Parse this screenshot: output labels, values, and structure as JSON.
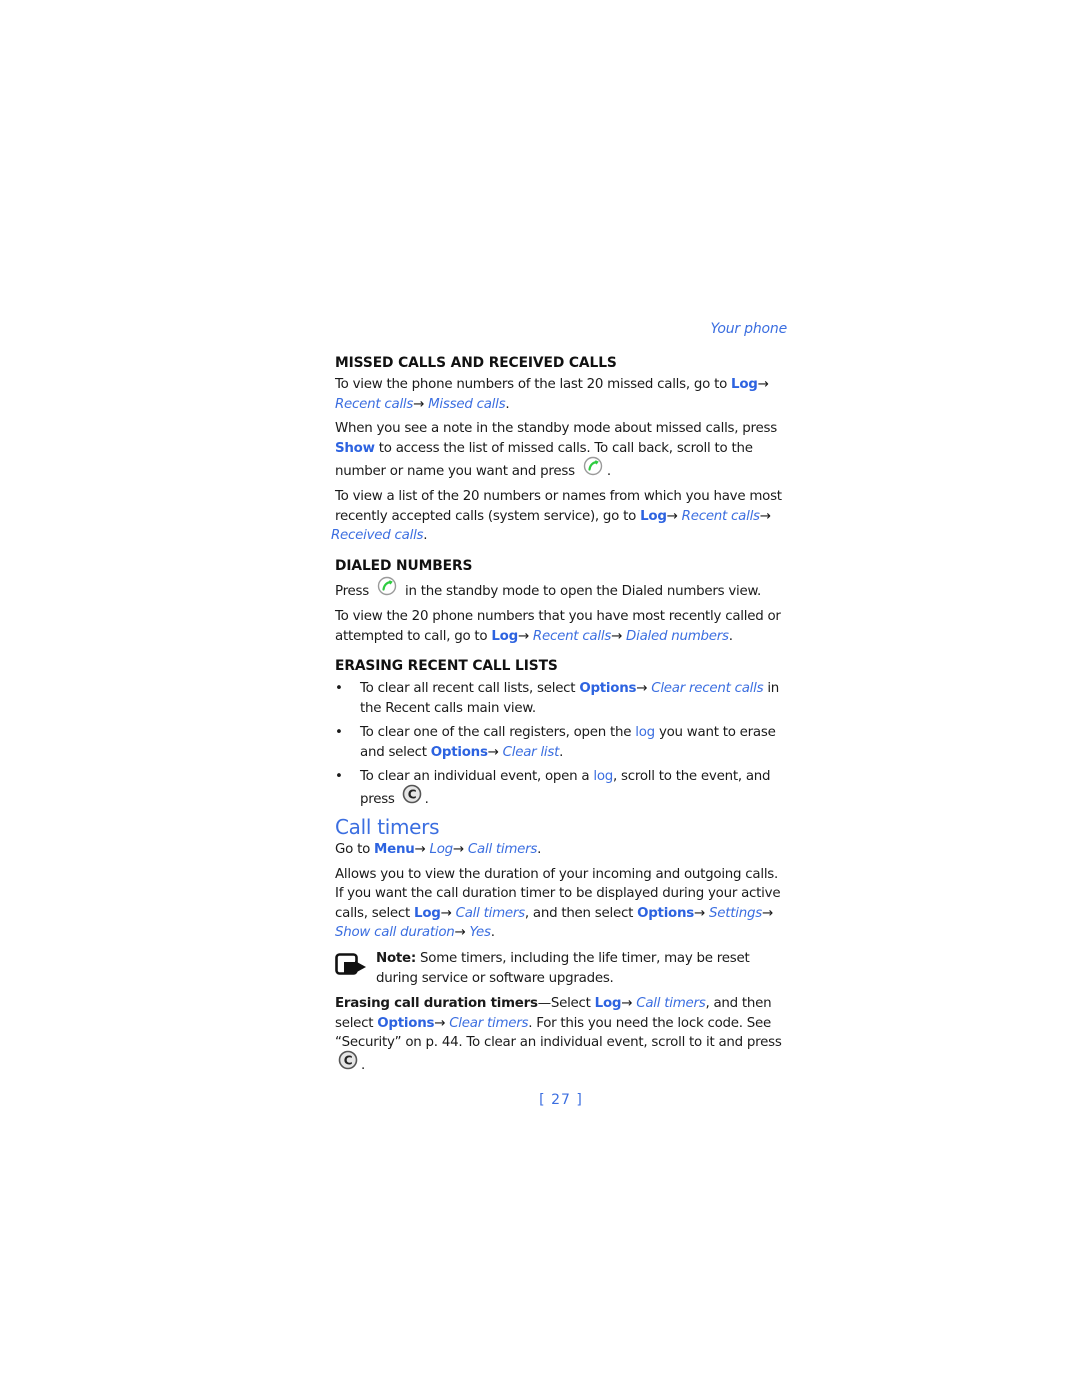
{
  "running_head": "Your phone",
  "missed_received": {
    "heading": "MISSED CALLS AND RECEIVED CALLS",
    "p1": {
      "t1": "To view the phone numbers of the last 20 missed calls, go to ",
      "log": "Log",
      "arrow": "→",
      "recent": " Recent calls",
      "missed": " Missed calls",
      "end": "."
    },
    "p2": {
      "t1": "When you see a note in the standby mode about missed calls, press ",
      "show": "Show",
      "t2": " to access the list of missed calls. To call back, scroll to the number or name you want and press",
      "end": "."
    },
    "p3": {
      "t1": "To view a list of the 20 numbers or names from which you have most recently accepted calls (system service), go to ",
      "log": "Log",
      "recent": " Recent calls",
      "received": " Received calls",
      "end": "."
    }
  },
  "dialed": {
    "heading": "DIALED NUMBERS",
    "p1": {
      "t1": "Press",
      "t2": "in the standby mode to open the Dialed numbers view."
    },
    "p2": {
      "t1": "To view the 20 phone numbers that you have most recently called or attempted to call, go to ",
      "log": "Log",
      "recent": " Recent calls",
      "dialed": " Dialed numbers",
      "end": "."
    }
  },
  "erasing": {
    "heading": "ERASING RECENT CALL LISTS",
    "bullet": "•",
    "items": [
      {
        "t1": "To clear all recent call lists, select ",
        "options": "Options",
        "link": " Clear recent calls",
        "t2": " in the Recent calls main view."
      },
      {
        "t1": "To clear one of the call registers, open the ",
        "log": "log",
        "t2": " you want to erase and select ",
        "options": "Options",
        "link": " Clear list",
        "end": "."
      },
      {
        "t1": "To clear an individual event, open a ",
        "log": "log",
        "t2": ", scroll to the event, and press",
        "end": "."
      }
    ]
  },
  "call_timers": {
    "title": "Call timers",
    "goto": {
      "t1": "Go to ",
      "menu": "Menu",
      "log": " Log",
      "timers": " Call timers",
      "end": "."
    },
    "p1": {
      "t1": "Allows you to view the duration of your incoming and outgoing calls. If you want the call duration timer to be displayed during your active calls, select ",
      "log": "Log",
      "timers": " Call timers",
      "t2": ", and then select ",
      "options": "Options",
      "settings": " Settings",
      "show": " Show call duration",
      "yes": " Yes",
      "end": "."
    },
    "note": {
      "label": "Note:",
      "text": " Some timers, including the life timer, may be reset during service or software upgrades."
    },
    "erase": {
      "label": "Erasing call duration timers",
      "t1": "—Select ",
      "log": "Log",
      "timers": " Call timers",
      "t2": ", and then select ",
      "options": "Options",
      "clear": " Clear timers",
      "t3": ". For this you need the lock code. See “Security” on p. 44. To clear an individual event, scroll to it and press",
      "end": "."
    }
  },
  "page_number": "[ 27 ]",
  "colors": {
    "link": "#3b6ee0",
    "call_key_green": "#2ecc40"
  }
}
